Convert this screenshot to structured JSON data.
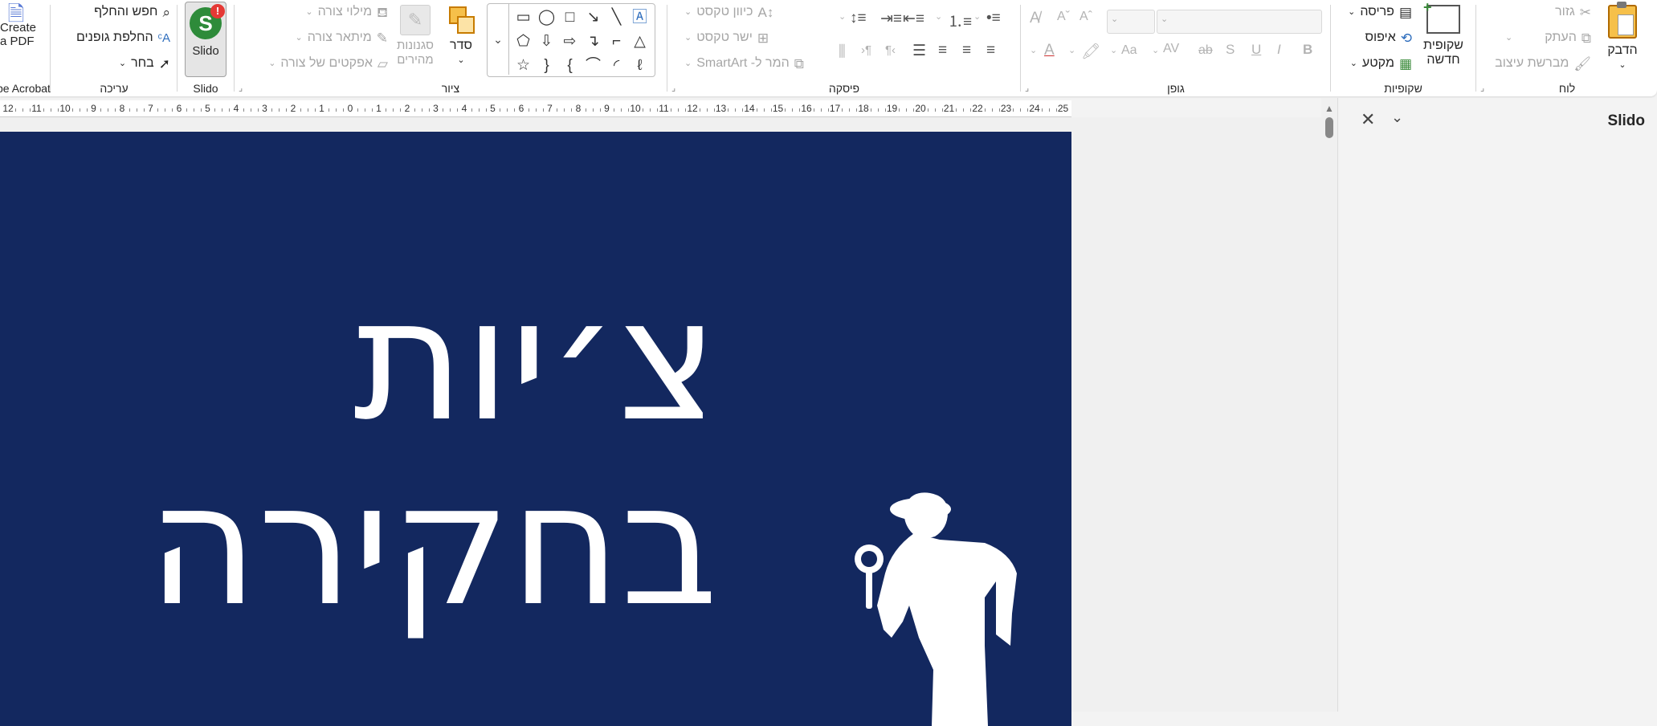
{
  "ribbon": {
    "acrobat": {
      "create_pdf": "Create\na PDF",
      "group_label": "pe Acrobat"
    },
    "editing": {
      "group_label": "עריכה",
      "find_replace": "חפש והחלף",
      "replace_fonts": "החלפת גופנים",
      "select": "בחר"
    },
    "slido": {
      "button": "Slido",
      "group_label": "Slido",
      "badge": "!"
    },
    "drawing": {
      "group_label": "ציור",
      "shape_fill": "מילוי צורה",
      "shape_outline": "מיתאר צורה",
      "shape_effects": "אפקטים של צורה",
      "quick_styles": "סגנונות\nמהירים",
      "arrange": "סדר"
    },
    "paragraph": {
      "group_label": "פיסקה",
      "text_direction": "כיוון טקסט",
      "align_text": "ישר טקסט",
      "convert_smartart": "המר ל- SmartArt"
    },
    "font": {
      "group_label": "גופן",
      "bold": "B",
      "italic": "I",
      "underline": "U",
      "shadow": "S",
      "strike": "ab",
      "spacing": "AV",
      "case": "Aa"
    },
    "slides": {
      "group_label": "שקופיות",
      "layout": "פריסה",
      "reset": "איפוס",
      "section": "מקטע",
      "new_slide": "שקופית\nחדשה"
    },
    "clipboard": {
      "group_label": "לוח",
      "cut": "גזור",
      "copy": "העתק",
      "format_painter": "מברשת עיצוב",
      "paste": "הדבק"
    }
  },
  "ruler": {
    "labels": [
      "12",
      "11",
      "10",
      "9",
      "8",
      "7",
      "6",
      "5",
      "4",
      "3",
      "2",
      "1",
      "0",
      "1",
      "2",
      "3",
      "4",
      "5",
      "6",
      "7",
      "8",
      "9",
      "10",
      "11",
      "12",
      "13",
      "14",
      "15",
      "16",
      "17",
      "18",
      "19",
      "20",
      "21",
      "22",
      "23",
      "24",
      "25"
    ]
  },
  "slide": {
    "background": "#13285f",
    "line1": "צ׳יות",
    "line2": "בחקירה"
  },
  "task_pane": {
    "title": "Slido"
  },
  "colors": {
    "accent_green": "#2e7d32",
    "badge_red": "#e53935",
    "slide_bg": "#13285f"
  }
}
